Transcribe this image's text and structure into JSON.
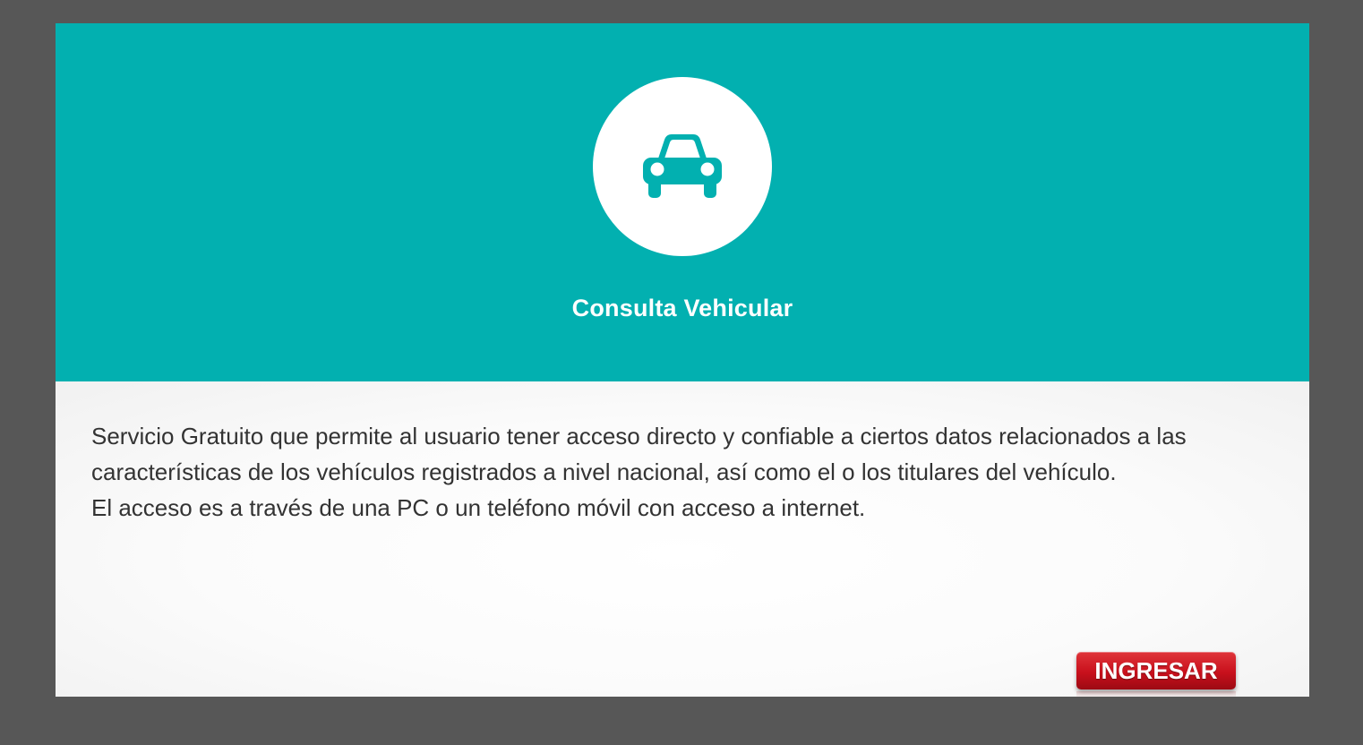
{
  "header": {
    "icon": "car-icon",
    "title": "Consulta Vehicular",
    "background_color": "#02b0b0",
    "icon_color": "#02b0b0"
  },
  "body": {
    "description_lines": [
      "Servicio Gratuito que permite al usuario tener acceso directo y confiable a ciertos datos relacionados a las",
      "características de los vehículos registrados a nivel nacional, así como el o los titulares del vehículo.",
      "El acceso es a través de una PC o un teléfono móvil con acceso a internet."
    ]
  },
  "actions": {
    "ingresar_label": "INGRESAR",
    "button_color": "#c8101c"
  },
  "page": {
    "background_color": "#575757"
  }
}
